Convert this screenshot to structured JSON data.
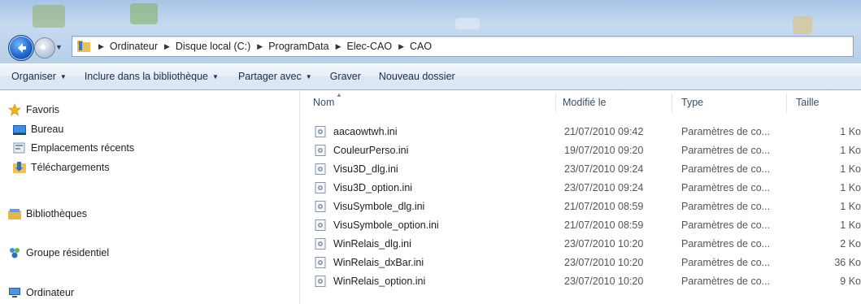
{
  "address": {
    "breadcrumbs": [
      "Ordinateur",
      "Disque local (C:)",
      "ProgramData",
      "Elec-CAO",
      "CAO"
    ]
  },
  "toolbar": {
    "organize": "Organiser",
    "include_library": "Inclure dans la bibliothèque",
    "share_with": "Partager avec",
    "burn": "Graver",
    "new_folder": "Nouveau dossier"
  },
  "navpane": {
    "favorites": "Favoris",
    "desktop": "Bureau",
    "recent_places": "Emplacements récents",
    "downloads": "Téléchargements",
    "libraries": "Bibliothèques",
    "homegroup": "Groupe résidentiel",
    "computer": "Ordinateur"
  },
  "columns": {
    "name": "Nom",
    "modified": "Modifié le",
    "type": "Type",
    "size": "Taille"
  },
  "files": [
    {
      "name": "aacaowtwh.ini",
      "date": "21/07/2010 09:42",
      "type": "Paramètres de co...",
      "size": "1 Ko"
    },
    {
      "name": "CouleurPerso.ini",
      "date": "19/07/2010 09:20",
      "type": "Paramètres de co...",
      "size": "1 Ko"
    },
    {
      "name": "Visu3D_dlg.ini",
      "date": "23/07/2010 09:24",
      "type": "Paramètres de co...",
      "size": "1 Ko"
    },
    {
      "name": "Visu3D_option.ini",
      "date": "23/07/2010 09:24",
      "type": "Paramètres de co...",
      "size": "1 Ko"
    },
    {
      "name": "VisuSymbole_dlg.ini",
      "date": "21/07/2010 08:59",
      "type": "Paramètres de co...",
      "size": "1 Ko"
    },
    {
      "name": "VisuSymbole_option.ini",
      "date": "21/07/2010 08:59",
      "type": "Paramètres de co...",
      "size": "1 Ko"
    },
    {
      "name": "WinRelais_dlg.ini",
      "date": "23/07/2010 10:20",
      "type": "Paramètres de co...",
      "size": "2 Ko"
    },
    {
      "name": "WinRelais_dxBar.ini",
      "date": "23/07/2010 10:20",
      "type": "Paramètres de co...",
      "size": "36 Ko"
    },
    {
      "name": "WinRelais_option.ini",
      "date": "23/07/2010 10:20",
      "type": "Paramètres de co...",
      "size": "9 Ko"
    }
  ]
}
